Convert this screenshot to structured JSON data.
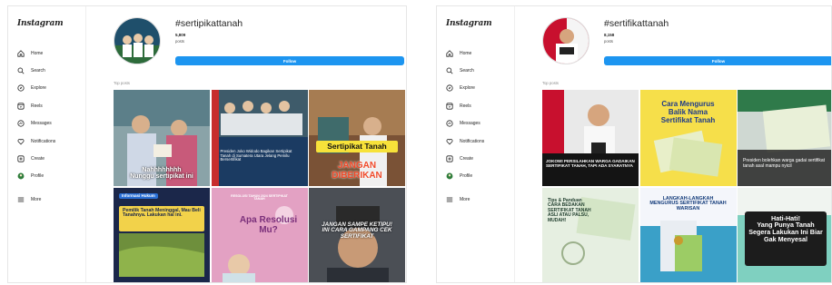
{
  "screens": [
    {
      "brand": "Instagram",
      "nav": [
        {
          "label": "Home",
          "icon": "home-icon"
        },
        {
          "label": "Search",
          "icon": "search-icon"
        },
        {
          "label": "Explore",
          "icon": "explore-icon"
        },
        {
          "label": "Reels",
          "icon": "reels-icon"
        },
        {
          "label": "Messages",
          "icon": "messages-icon"
        },
        {
          "label": "Notifications",
          "icon": "heart-icon"
        },
        {
          "label": "Create",
          "icon": "create-icon"
        },
        {
          "label": "Profile",
          "icon": "profile-icon"
        }
      ],
      "more": "More",
      "hashtag": "#sertipikattanah",
      "post_count": "5,809",
      "post_label": "posts",
      "follow_label": "Follow",
      "top_posts_label": "Top posts",
      "tiles": [
        {
          "caption": "Nahhhhhhhh\nNunggu sertipikat ini"
        },
        {
          "caption": "Presiden Joko Widodo Bagikan Sertipikat Tanah di Sumatera Utara Jelang Pemilu Bersertifikat"
        },
        {
          "caption_top": "Sertipikat Tanah",
          "caption_bottom": "JANGAN\nDIBERIKAN"
        },
        {
          "badge": "Informasi Hukum",
          "caption": "Pemilik Tanah Meninggal, Mau Beli Tanahnya. Lakukan hal ini."
        },
        {
          "badge": "RESOLUSI TAHUN 2024 SERTIPIKAT TANAH",
          "caption": "Apa Resolusi\nMu?"
        },
        {
          "caption": "JANGAN SAMPE KETIPU!\nINI CARA GAMPANG CEK\nSERTIFIKAT"
        }
      ]
    },
    {
      "brand": "Instagram",
      "nav": [
        {
          "label": "Home",
          "icon": "home-icon"
        },
        {
          "label": "Search",
          "icon": "search-icon"
        },
        {
          "label": "Explore",
          "icon": "explore-icon"
        },
        {
          "label": "Reels",
          "icon": "reels-icon"
        },
        {
          "label": "Messages",
          "icon": "messages-icon"
        },
        {
          "label": "Notifications",
          "icon": "heart-icon"
        },
        {
          "label": "Create",
          "icon": "create-icon"
        },
        {
          "label": "Profile",
          "icon": "profile-icon"
        }
      ],
      "more": "More",
      "hashtag": "#sertifikattanah",
      "post_count": "8,158",
      "post_label": "posts",
      "follow_label": "Follow",
      "top_posts_label": "Top posts",
      "tiles": [
        {
          "caption": "JOKOWI PERSILAHKAN WARGA GADAIKAN SERTIFIKAT TANAH, TAPI ADA SYARATNYA"
        },
        {
          "caption": "Cara Mengurus Balik Nama Sertifikat Tanah"
        },
        {
          "caption": "Presiden bolehkan warga gadai sertifikat tanah asal mampu nyicil"
        },
        {
          "caption": "Tips & Panduan\nCARA BEDAKAN SERTIFIKAT TANAH ASLI ATAU PALSU, MUDAH!"
        },
        {
          "caption": "LANGKAH-LANGKAH MENGURUS SERTIFIKAT TANAH WARISAN"
        },
        {
          "caption": "Hati-Hati!\nYang Punya Tanah Segera Lakukan Ini Biar Gak Menyesal"
        }
      ]
    }
  ]
}
